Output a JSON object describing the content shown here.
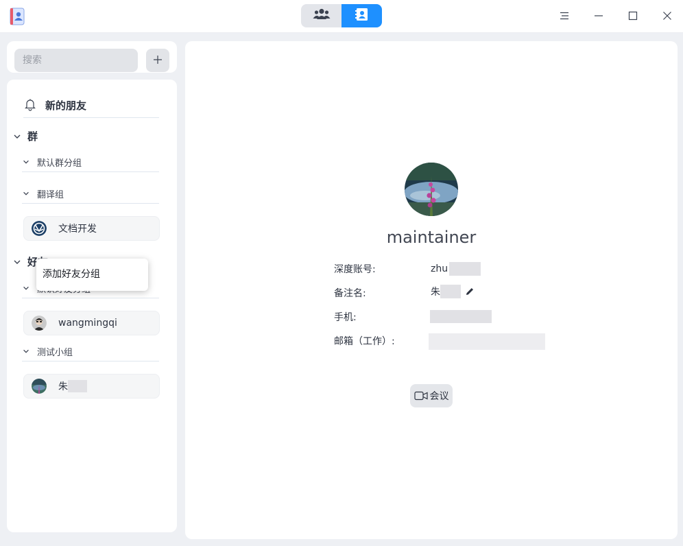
{
  "titlebar": {
    "app_icon": "contacts-app-icon",
    "view_switch": [
      {
        "icon": "group-people-icon",
        "active": false
      },
      {
        "icon": "contact-card-icon",
        "active": true
      }
    ],
    "window_buttons": [
      "menu-icon",
      "minimize-icon",
      "maximize-icon",
      "close-icon"
    ]
  },
  "sidebar": {
    "search_placeholder": "搜索",
    "add_icon": "plus-icon",
    "new_friends_label": "新的朋友",
    "groups_header": "群",
    "group_folders": [
      {
        "label": "默认群分组",
        "items": []
      },
      {
        "label": "翻译组",
        "items": [
          {
            "name": "文档开发",
            "avatar": "deepin-logo-icon"
          }
        ]
      }
    ],
    "friends_header": "好友",
    "friend_folders": [
      {
        "label": "默认好友分组",
        "items": [
          {
            "name": "wangmingqi",
            "avatar": "user-photo"
          }
        ]
      },
      {
        "label": "测试小组",
        "items": [
          {
            "name": "朱",
            "avatar": "user-photo"
          }
        ]
      }
    ]
  },
  "context_menu": {
    "items": [
      "添加好友分组"
    ]
  },
  "detail": {
    "username": "maintainer",
    "fields": [
      {
        "label": "深度账号:",
        "value": "zhu"
      },
      {
        "label": "备注名:",
        "value": "朱"
      },
      {
        "label": "手机:",
        "value": ""
      },
      {
        "label": "邮箱（工作）:",
        "value": ""
      }
    ],
    "edit_icon": "pencil-icon",
    "meeting_label": "会议",
    "meeting_icon": "video-camera-icon"
  },
  "colors": {
    "accent": "#1e90ff",
    "background": "#eef0f4",
    "panel": "#ffffff"
  }
}
